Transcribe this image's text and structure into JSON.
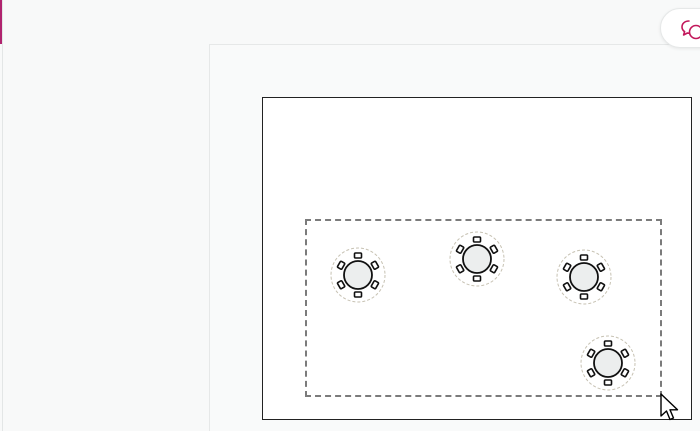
{
  "icons": {
    "comments": "comments-icon",
    "table": "round-table-with-chairs-icon",
    "cursor": "mouse-pointer-icon"
  },
  "colors": {
    "accent": "#b0246f",
    "room_border": "#222222",
    "selection": "#7b7b7b",
    "table_fill": "#eceeee",
    "table_halo": "#c7c2b3",
    "comment_icon": "#c2185b"
  },
  "floor_plan": {
    "tables": [
      {
        "id": "table-1",
        "chairs": 6
      },
      {
        "id": "table-2",
        "chairs": 6
      },
      {
        "id": "table-3",
        "chairs": 6
      },
      {
        "id": "table-4",
        "chairs": 6
      }
    ]
  }
}
